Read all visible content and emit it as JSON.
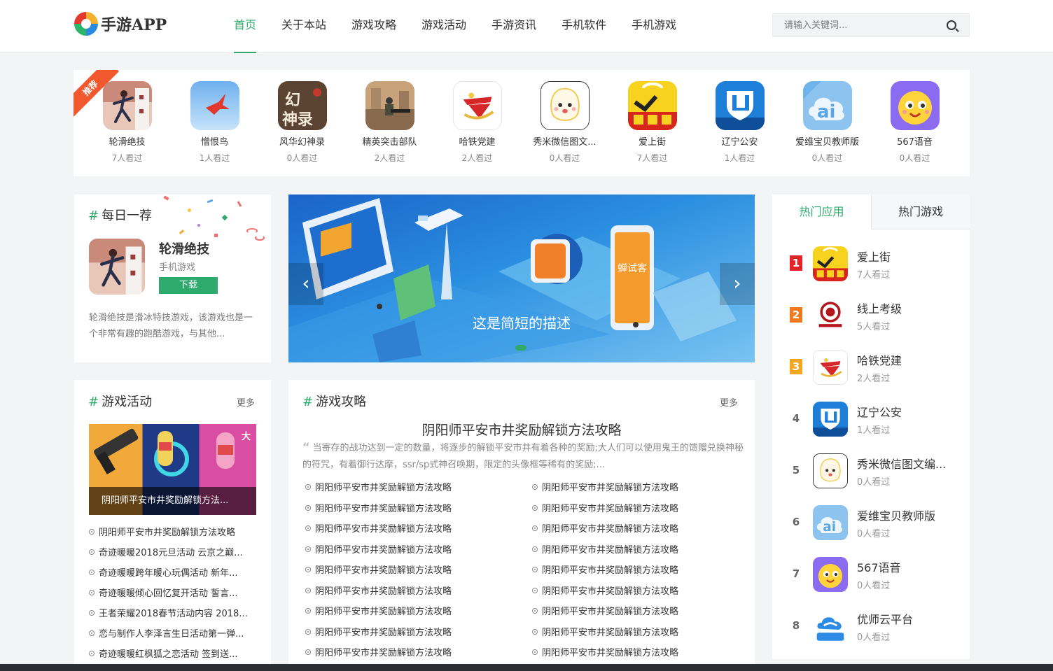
{
  "site": {
    "logo_text": "手游APP"
  },
  "nav": {
    "items": [
      {
        "label": "首页",
        "active": true
      },
      {
        "label": "关于本站"
      },
      {
        "label": "游戏攻略"
      },
      {
        "label": "游戏活动"
      },
      {
        "label": "手游资讯"
      },
      {
        "label": "手机软件"
      },
      {
        "label": "手机游戏"
      }
    ]
  },
  "search": {
    "placeholder": "请输入关键词..."
  },
  "recommend": {
    "ribbon": "推荐",
    "items": [
      {
        "name": "轮滑绝技",
        "views": "7人看过",
        "icon": "skate-game-icon"
      },
      {
        "name": "憎恨鸟",
        "views": "1人看过",
        "icon": "red-bird-icon"
      },
      {
        "name": "风华幻神录",
        "views": "0人看过",
        "icon": "fantasy-calligraphy-icon"
      },
      {
        "name": "精英突击部队",
        "views": "2人看过",
        "icon": "soldier-shooter-icon"
      },
      {
        "name": "哈铁党建",
        "views": "2人看过",
        "icon": "party-emblem-icon"
      },
      {
        "name": "秀米微信图文...",
        "views": "0人看过",
        "icon": "rice-mascot-icon"
      },
      {
        "name": "爱上街",
        "views": "7人看过",
        "icon": "shopping-bag-icon"
      },
      {
        "name": "辽宁公安",
        "views": "1人看过",
        "icon": "police-shield-icon"
      },
      {
        "name": "爱维宝贝教师版",
        "views": "0人看过",
        "icon": "ai-cloud-icon"
      },
      {
        "name": "567语音",
        "views": "0人看过",
        "icon": "smiley-voice-icon"
      }
    ]
  },
  "daily": {
    "title": "每日一荐",
    "name": "轮滑绝技",
    "category": "手机游戏",
    "download_label": "下载",
    "description": "轮滑绝技是滑冰特技游戏，该游戏也是一个非常有趣的跑酷游戏，与其他..."
  },
  "banner": {
    "caption": "这是简短的描述",
    "prev": "‹",
    "next": "›"
  },
  "hot": {
    "tabs": [
      {
        "label": "热门应用",
        "active": true
      },
      {
        "label": "热门游戏"
      }
    ],
    "items": [
      {
        "rank": "1",
        "name": "爱上街",
        "views": "7人看过",
        "icon": "shopping-bag-icon",
        "badge": "#e6212a"
      },
      {
        "rank": "2",
        "name": "线上考级",
        "views": "5人看过",
        "icon": "exam-emblem-icon",
        "badge": "#f07a22"
      },
      {
        "rank": "3",
        "name": "哈铁党建",
        "views": "2人看过",
        "icon": "party-emblem-icon",
        "badge": "#f5a623"
      },
      {
        "rank": "4",
        "name": "辽宁公安",
        "views": "1人看过",
        "icon": "police-shield-icon"
      },
      {
        "rank": "5",
        "name": "秀米微信图文编...",
        "views": "0人看过",
        "icon": "rice-mascot-icon"
      },
      {
        "rank": "6",
        "name": "爱维宝贝教师版",
        "views": "0人看过",
        "icon": "ai-cloud-icon"
      },
      {
        "rank": "7",
        "name": "567语音",
        "views": "0人看过",
        "icon": "smiley-voice-icon"
      },
      {
        "rank": "8",
        "name": "优师云平台",
        "views": "0人看过",
        "icon": "cloud-teacher-icon"
      }
    ]
  },
  "activity": {
    "title": "游戏活动",
    "more": "更多",
    "featured_caption": "阴阳师平安市井奖励解锁方法...",
    "items": [
      "阴阳师平安市井奖励解锁方法攻略",
      "奇迹暖暖2018元旦活动 云京之巅...",
      "奇迹暖暖跨年暖心玩偶活动 新年...",
      "奇迹暖暖倾心回忆复开活动 誓言...",
      "王者荣耀2018春节活动内容 2018...",
      "恋与制作人李泽言生日活动第一弹...",
      "奇迹暖暖红枫狐之恋活动 签到送..."
    ]
  },
  "guide": {
    "title": "游戏攻略",
    "more": "更多",
    "headline": "阴阳师平安市井奖励解锁方法攻略",
    "summary": "当寄存的战功达到一定的数量，将逐步的解锁平安市井有着各种的奖励;大人们可以使用鬼王的馈赠兑换神秘的符咒，有着御行达摩，ssr/sp式神召唤期，限定的头像框等稀有的奖励;...",
    "items": [
      "阴阳师平安市井奖励解锁方法攻略",
      "阴阳师平安市井奖励解锁方法攻略",
      "阴阳师平安市井奖励解锁方法攻略",
      "阴阳师平安市井奖励解锁方法攻略",
      "阴阳师平安市井奖励解锁方法攻略",
      "阴阳师平安市井奖励解锁方法攻略",
      "阴阳师平安市井奖励解锁方法攻略",
      "阴阳师平安市井奖励解锁方法攻略",
      "阴阳师平安市井奖励解锁方法攻略",
      "阴阳师平安市井奖励解锁方法攻略",
      "阴阳师平安市井奖励解锁方法攻略",
      "阴阳师平安市井奖励解锁方法攻略",
      "阴阳师平安市井奖励解锁方法攻略",
      "阴阳师平安市井奖励解锁方法攻略",
      "阴阳师平安市井奖励解锁方法攻略",
      "阴阳师平安市井奖励解锁方法攻略",
      "阴阳师平安市井奖励解锁方法攻略",
      "阴阳师平安市井奖励解锁方法攻略"
    ]
  },
  "colors": {
    "accent": "#2eaa6d",
    "ribbon": "#f2582d"
  }
}
